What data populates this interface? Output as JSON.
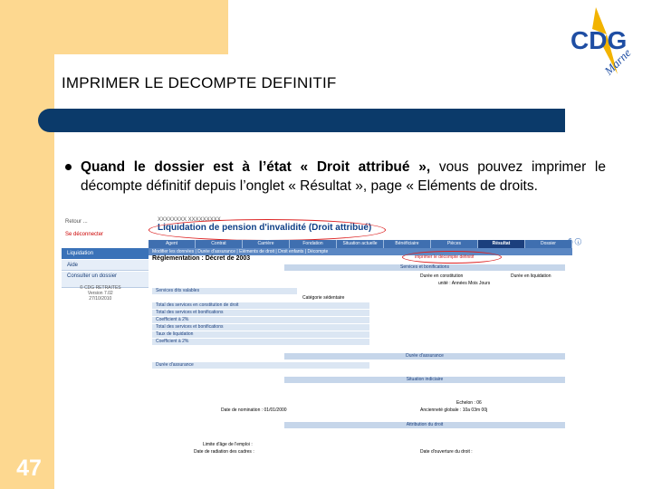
{
  "slide": {
    "number": "47",
    "title": "IMPRIMER LE DECOMPTE DEFINITIF",
    "bullet_bold": "Quand le dossier est à l’état « Droit attribué »,",
    "bullet_rest": " vous pouvez imprimer le décompte définitif depuis l’onglet « Résultat », page « Eléments de droits."
  },
  "logo": {
    "text": "CDG",
    "subtext": "Marne"
  },
  "screenshot": {
    "side_top": "Retour ...",
    "logout": "Se déconnecter",
    "menu": [
      "Liquidation",
      "Aide",
      "Consulter un dossier"
    ],
    "footer_lines": [
      "© CDG RETRAITES",
      "Version 7.02",
      "27/10/2010"
    ],
    "breadcrumb": "XXXXXXXX XXXXXXXXX",
    "page_heading": "Liquidation de pension d'invalidité (Droit attribué)",
    "tabs": [
      "Agent",
      "Contrat",
      "Carrière",
      "Fondation",
      "Situation actuelle",
      "Bénéficiaire",
      "Pièces",
      "Résultat",
      "Dossier"
    ],
    "subtabs": "Modifier les données | Durée d'assurance | Eléments de droit | Droit enfants | Décompte",
    "oval_caption": "imprimer le décompte définitif",
    "reglementation": "Réglementation : Décret de 2003",
    "sections": [
      "Services et bonifications",
      "Durée d'assurance",
      "Situation indiciaire",
      "Attribution du droit"
    ],
    "rows": [
      "Services dits valables",
      "Total des services en constitution de droit",
      "Total des services et bonifications",
      "Coefficient à 2%",
      "Total des services et bonifications",
      "Taux de liquidation",
      "Coefficient à 2%",
      "Durée d'assurance"
    ],
    "values": {
      "duree_constitution": "Durée en constitution",
      "duree_liquidation": "Durée en liquidation",
      "unite": "unité : Années Mois Jours",
      "categorie": "Catégorie sédentaire",
      "date_nomination": "Date de nomination : 01/01/2000",
      "anciennete": "Ancienneté globale : 10a 03m 00j",
      "echelon": "Echelon : 06",
      "limite_age": "Limite d'âge de l'emploi :",
      "date_radiation": "Date de radiation des cadres :",
      "date_ouverture": "Date d'ouverture du droit :"
    }
  }
}
